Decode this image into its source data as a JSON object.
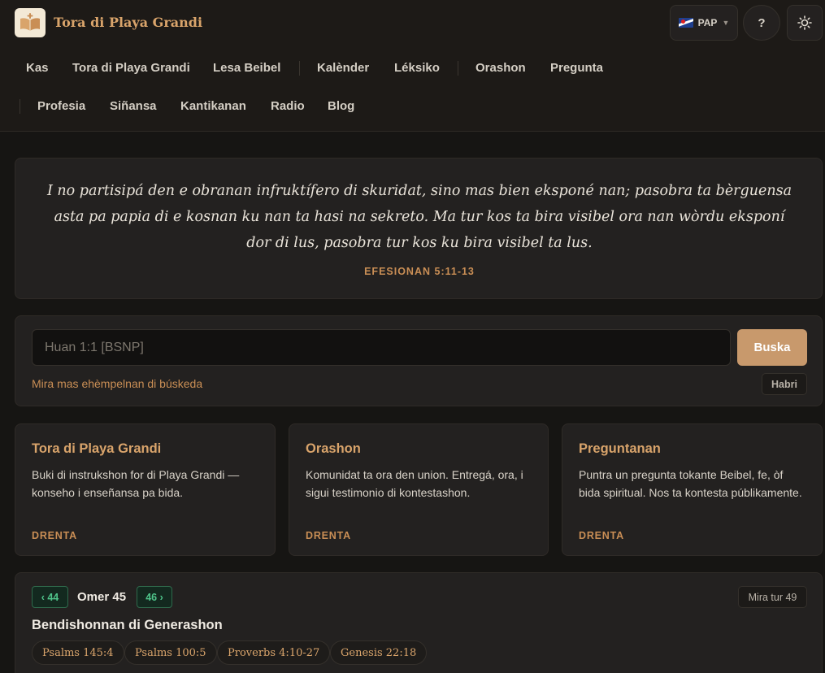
{
  "header": {
    "site_title": "Tora di Playa Grandi",
    "language_code": "PAP",
    "help_label": "?",
    "logo_icon": "open-book-icon",
    "theme_icon": "sun-icon"
  },
  "nav": {
    "items": [
      "Kas",
      "Tora di Playa Grandi",
      "Lesa Beibel",
      "Kalènder",
      "Léksiko",
      "Orashon",
      "Pregunta",
      "Profesia",
      "Siñansa",
      "Kantikanan",
      "Radio",
      "Blog"
    ]
  },
  "verse": {
    "text": "I no partisipá den e obranan infruktífero di skuridat, sino mas bien eksponé nan; pasobra ta bèrguensa asta pa papia di e kosnan ku nan ta hasi na sekreto. Ma tur kos ta bira visibel ora nan wòrdu eksponí dor di lus, pasobra tur kos ku bira visibel ta lus.",
    "reference": "EFESIONAN 5:11-13"
  },
  "search": {
    "placeholder": "Huan 1:1 [BSNP]",
    "button_label": "Buska",
    "examples_link": "Mira mas ehèmpelnan di búskeda",
    "open_label": "Habri"
  },
  "features": [
    {
      "title": "Tora di Playa Grandi",
      "description": "Buki di instrukshon for di Playa Grandi — konseho i enseñansa pa bida.",
      "link": "DRENTA"
    },
    {
      "title": "Orashon",
      "description": "Komunidat ta ora den union. Entregá, ora, i sigui testimonio di kontestashon.",
      "link": "DRENTA"
    },
    {
      "title": "Preguntanan",
      "description": "Puntra un pregunta tokante Beibel, fe, òf bida spiritual. Nos ta kontesta públikamente.",
      "link": "DRENTA"
    }
  ],
  "reading": {
    "prev_label": "‹ 44",
    "day_label": "Omer 45",
    "next_label": "46 ›",
    "see_all_label": "Mira tur 49",
    "title": "Bendishonnan di Generashon",
    "passages": [
      "Psalms 145:4",
      "Psalms 100:5",
      "Proverbs 4:10-27",
      "Genesis 22:18"
    ]
  },
  "colors": {
    "accent": "#d9a46b",
    "accent_dark": "#c98e55",
    "button": "#c8996c",
    "green": "#4fc48a",
    "background": "#161513",
    "card": "#232120"
  }
}
